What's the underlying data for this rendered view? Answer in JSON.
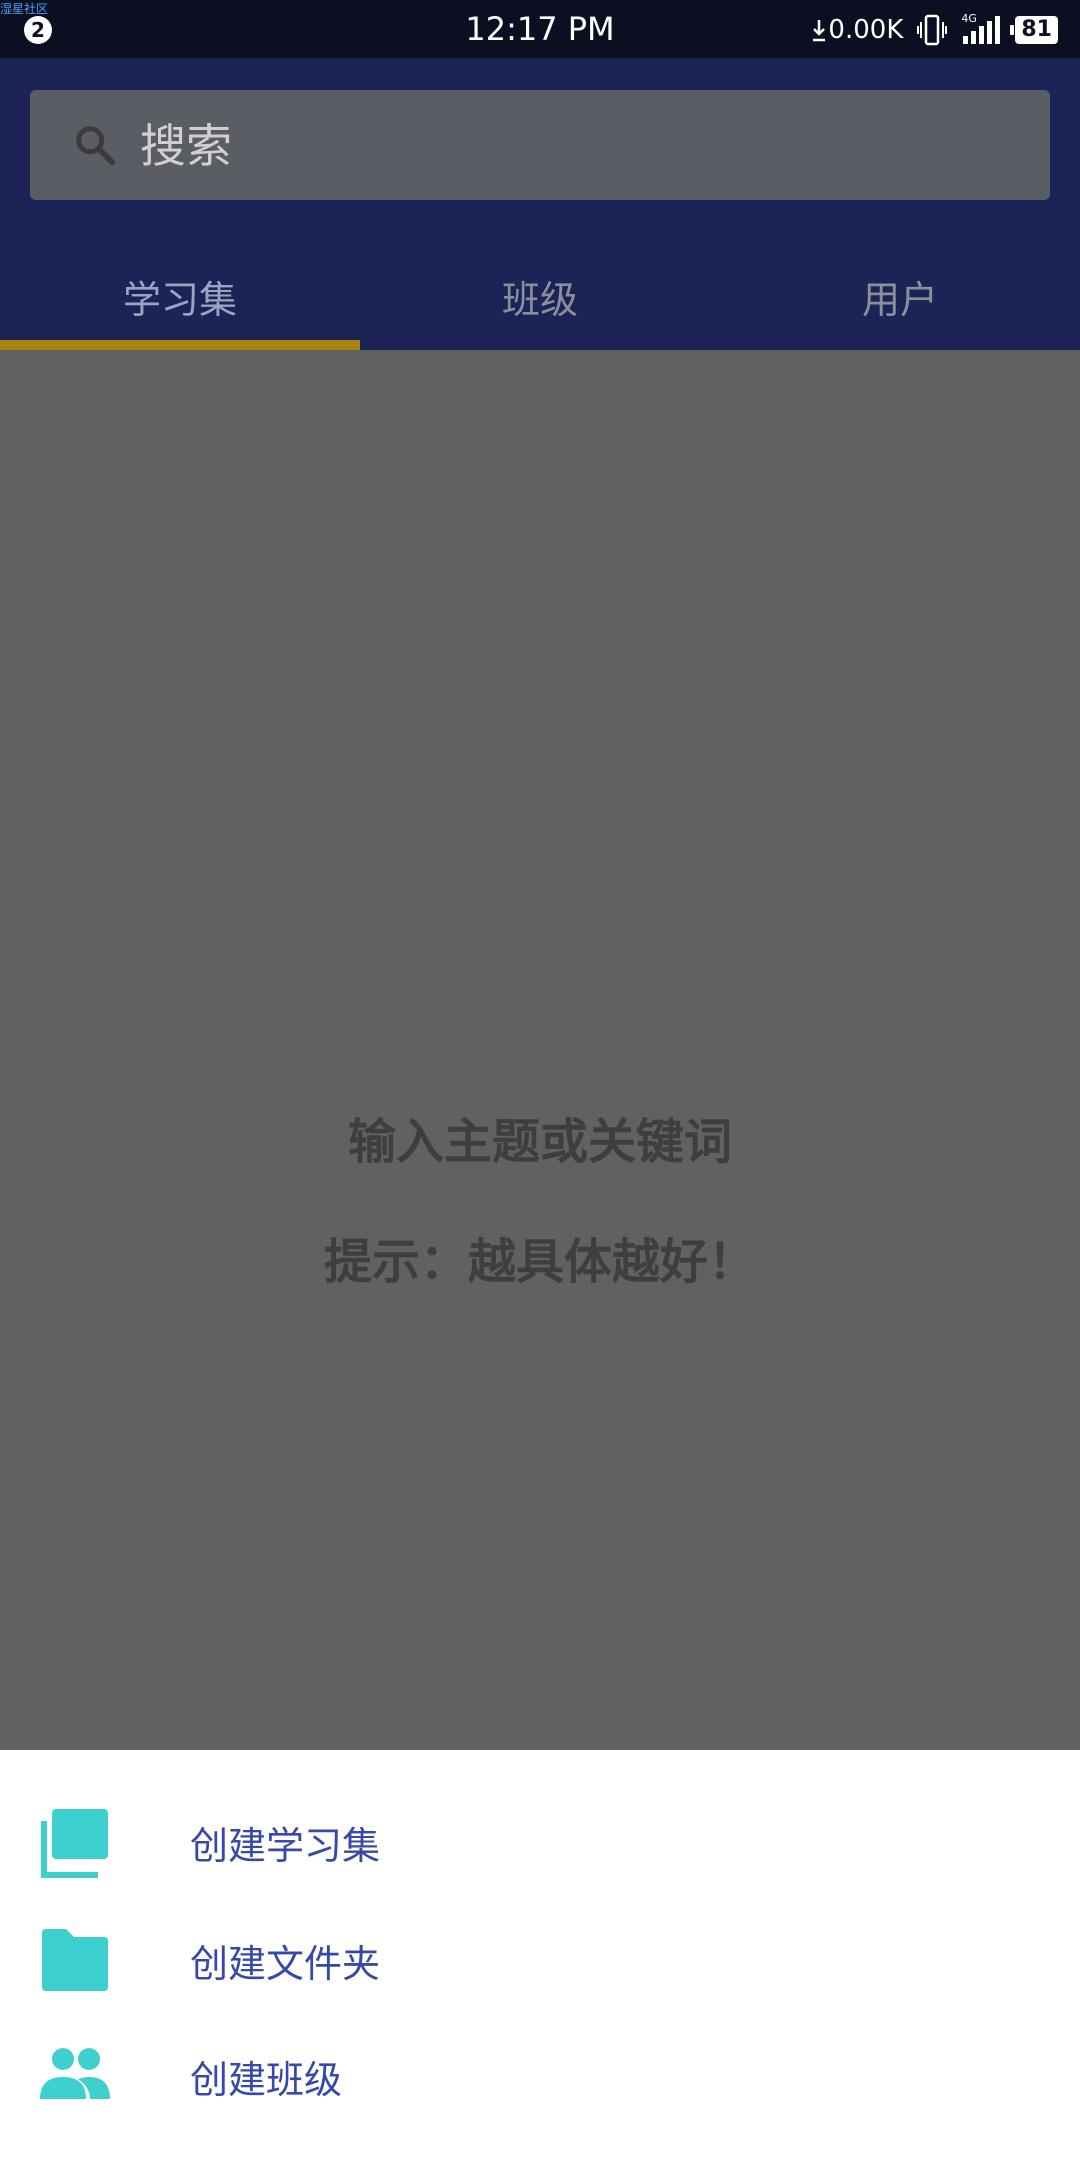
{
  "status_bar": {
    "corner_text": "湿星社区",
    "notification_count": "2",
    "time": "12:17 PM",
    "net_speed": "0.00K",
    "signal_label": "4G",
    "battery": "81"
  },
  "search": {
    "placeholder": "搜索"
  },
  "tabs": [
    {
      "label": "学习集",
      "active": true
    },
    {
      "label": "班级",
      "active": false
    },
    {
      "label": "用户",
      "active": false
    }
  ],
  "empty_state": {
    "line1": "输入主题或关键词",
    "line2": "提示：越具体越好！"
  },
  "bottom_sheet": {
    "items": [
      {
        "label": "创建学习集",
        "icon": "study-set-icon"
      },
      {
        "label": "创建文件夹",
        "icon": "folder-icon"
      },
      {
        "label": "创建班级",
        "icon": "class-group-icon"
      }
    ]
  },
  "colors": {
    "header": "#1b2357",
    "tab_indicator": "#a58510",
    "icon_accent": "#3ecfcf",
    "sheet_text": "#3748a8"
  }
}
